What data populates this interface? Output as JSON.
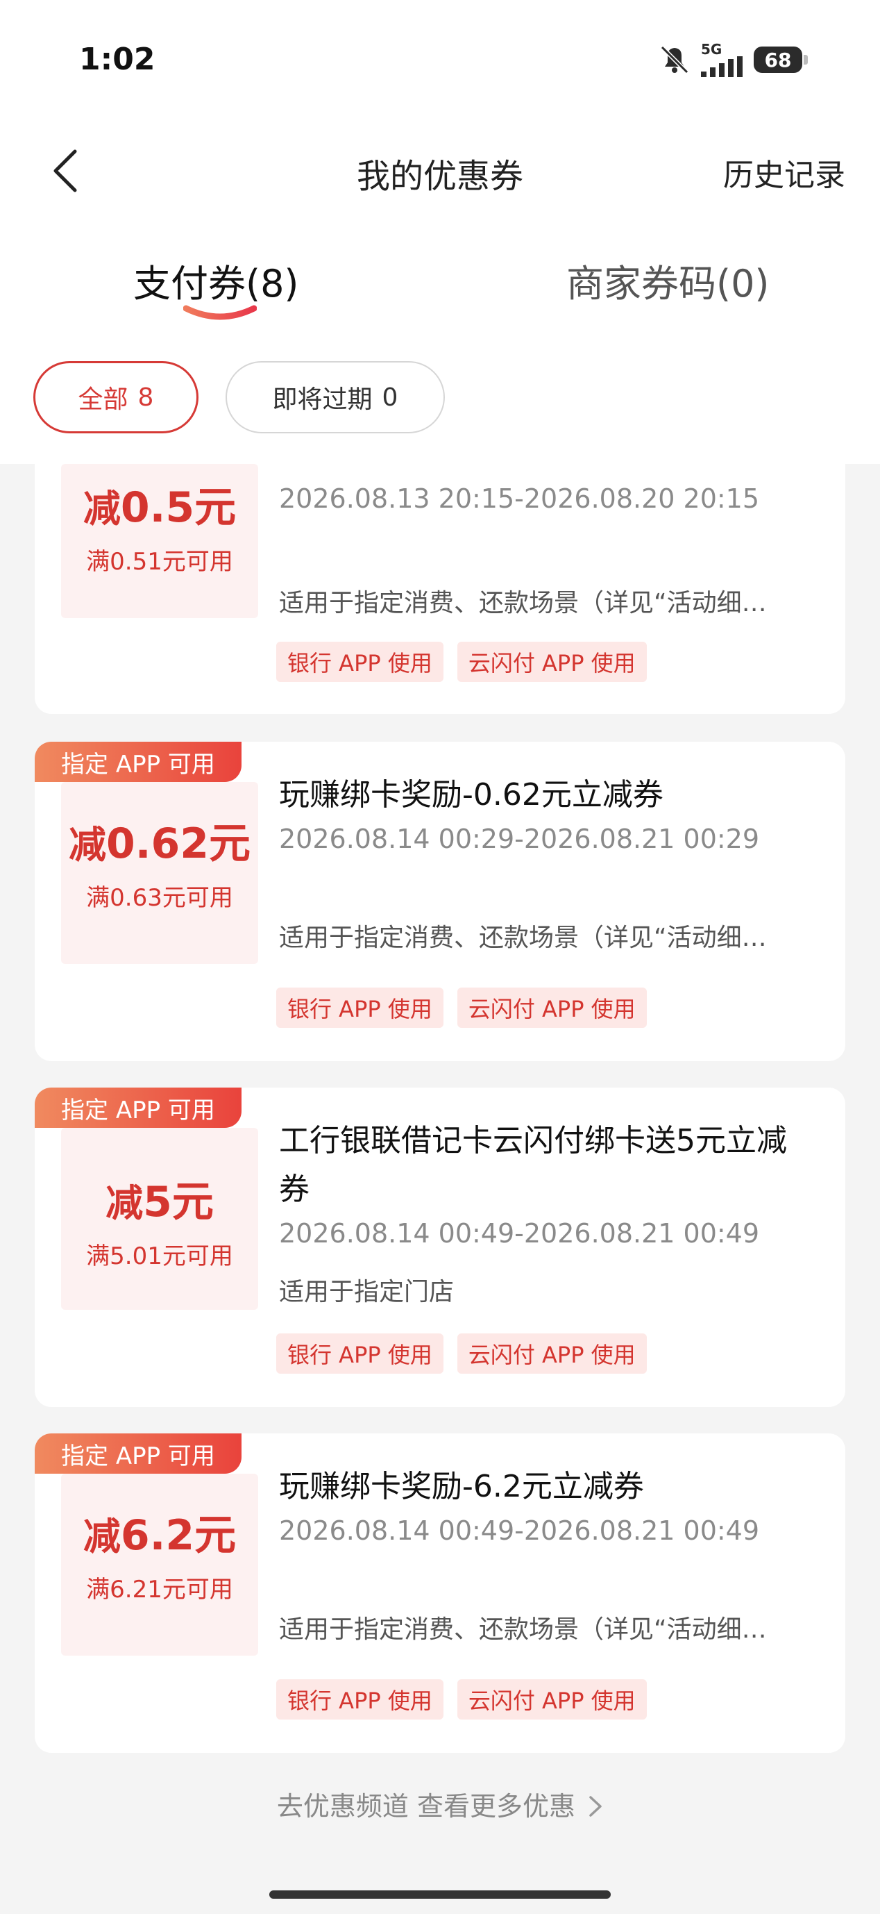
{
  "status_bar": {
    "time": "1:02",
    "network": "5G",
    "battery": "68"
  },
  "header": {
    "title": "我的优惠券",
    "history": "历史记录"
  },
  "tabs": [
    {
      "label": "支付券(8)",
      "active": true
    },
    {
      "label": "商家券码(0)",
      "active": false
    }
  ],
  "filters": [
    {
      "label": "全部",
      "count": "8",
      "active": true
    },
    {
      "label": "即将过期",
      "count": "0",
      "active": false
    }
  ],
  "coupons": [
    {
      "amount_prefix": "减",
      "amount": "0.5元",
      "min_spend": "满0.51元可用",
      "validity": "2026.08.13 20:15-2026.08.20 20:15",
      "scope": "适用于指定消费、还款场景（详见“活动细…",
      "tags": [
        "银行 APP 使用",
        "云闪付 APP 使用"
      ]
    },
    {
      "badge": "指定 APP 可用",
      "amount_prefix": "减",
      "amount": "0.62元",
      "min_spend": "满0.63元可用",
      "title": "玩赚绑卡奖励-0.62元立减券",
      "validity": "2026.08.14 00:29-2026.08.21 00:29",
      "scope": "适用于指定消费、还款场景（详见“活动细…",
      "tags": [
        "银行 APP 使用",
        "云闪付 APP 使用"
      ]
    },
    {
      "badge": "指定 APP 可用",
      "amount_prefix": "减",
      "amount": "5元",
      "min_spend": "满5.01元可用",
      "title_line1": "工行银联借记卡云闪付绑卡送5元立减",
      "title_line2": "券",
      "validity": "2026.08.14 00:49-2026.08.21 00:49",
      "scope": "适用于指定门店",
      "tags": [
        "银行 APP 使用",
        "云闪付 APP 使用"
      ]
    },
    {
      "badge": "指定 APP 可用",
      "amount_prefix": "减",
      "amount": "6.2元",
      "min_spend": "满6.21元可用",
      "title": "玩赚绑卡奖励-6.2元立减券",
      "validity": "2026.08.14 00:49-2026.08.21 00:49",
      "scope": "适用于指定消费、还款场景（详见“活动细…",
      "tags": [
        "银行 APP 使用",
        "云闪付 APP 使用"
      ]
    }
  ],
  "footer": {
    "link": "去优惠频道 查看更多优惠"
  },
  "colors": {
    "accent": "#d4352f",
    "tag_bg": "#fde8e6",
    "amount_bg": "#fdf1f1",
    "page_bg": "#f4f4f4"
  },
  "icons": {
    "back": "chevron-left-icon",
    "footer_arrow": "chevron-right-icon",
    "mute": "bell-off-icon",
    "signal": "signal-icon",
    "battery": "battery-icon"
  }
}
